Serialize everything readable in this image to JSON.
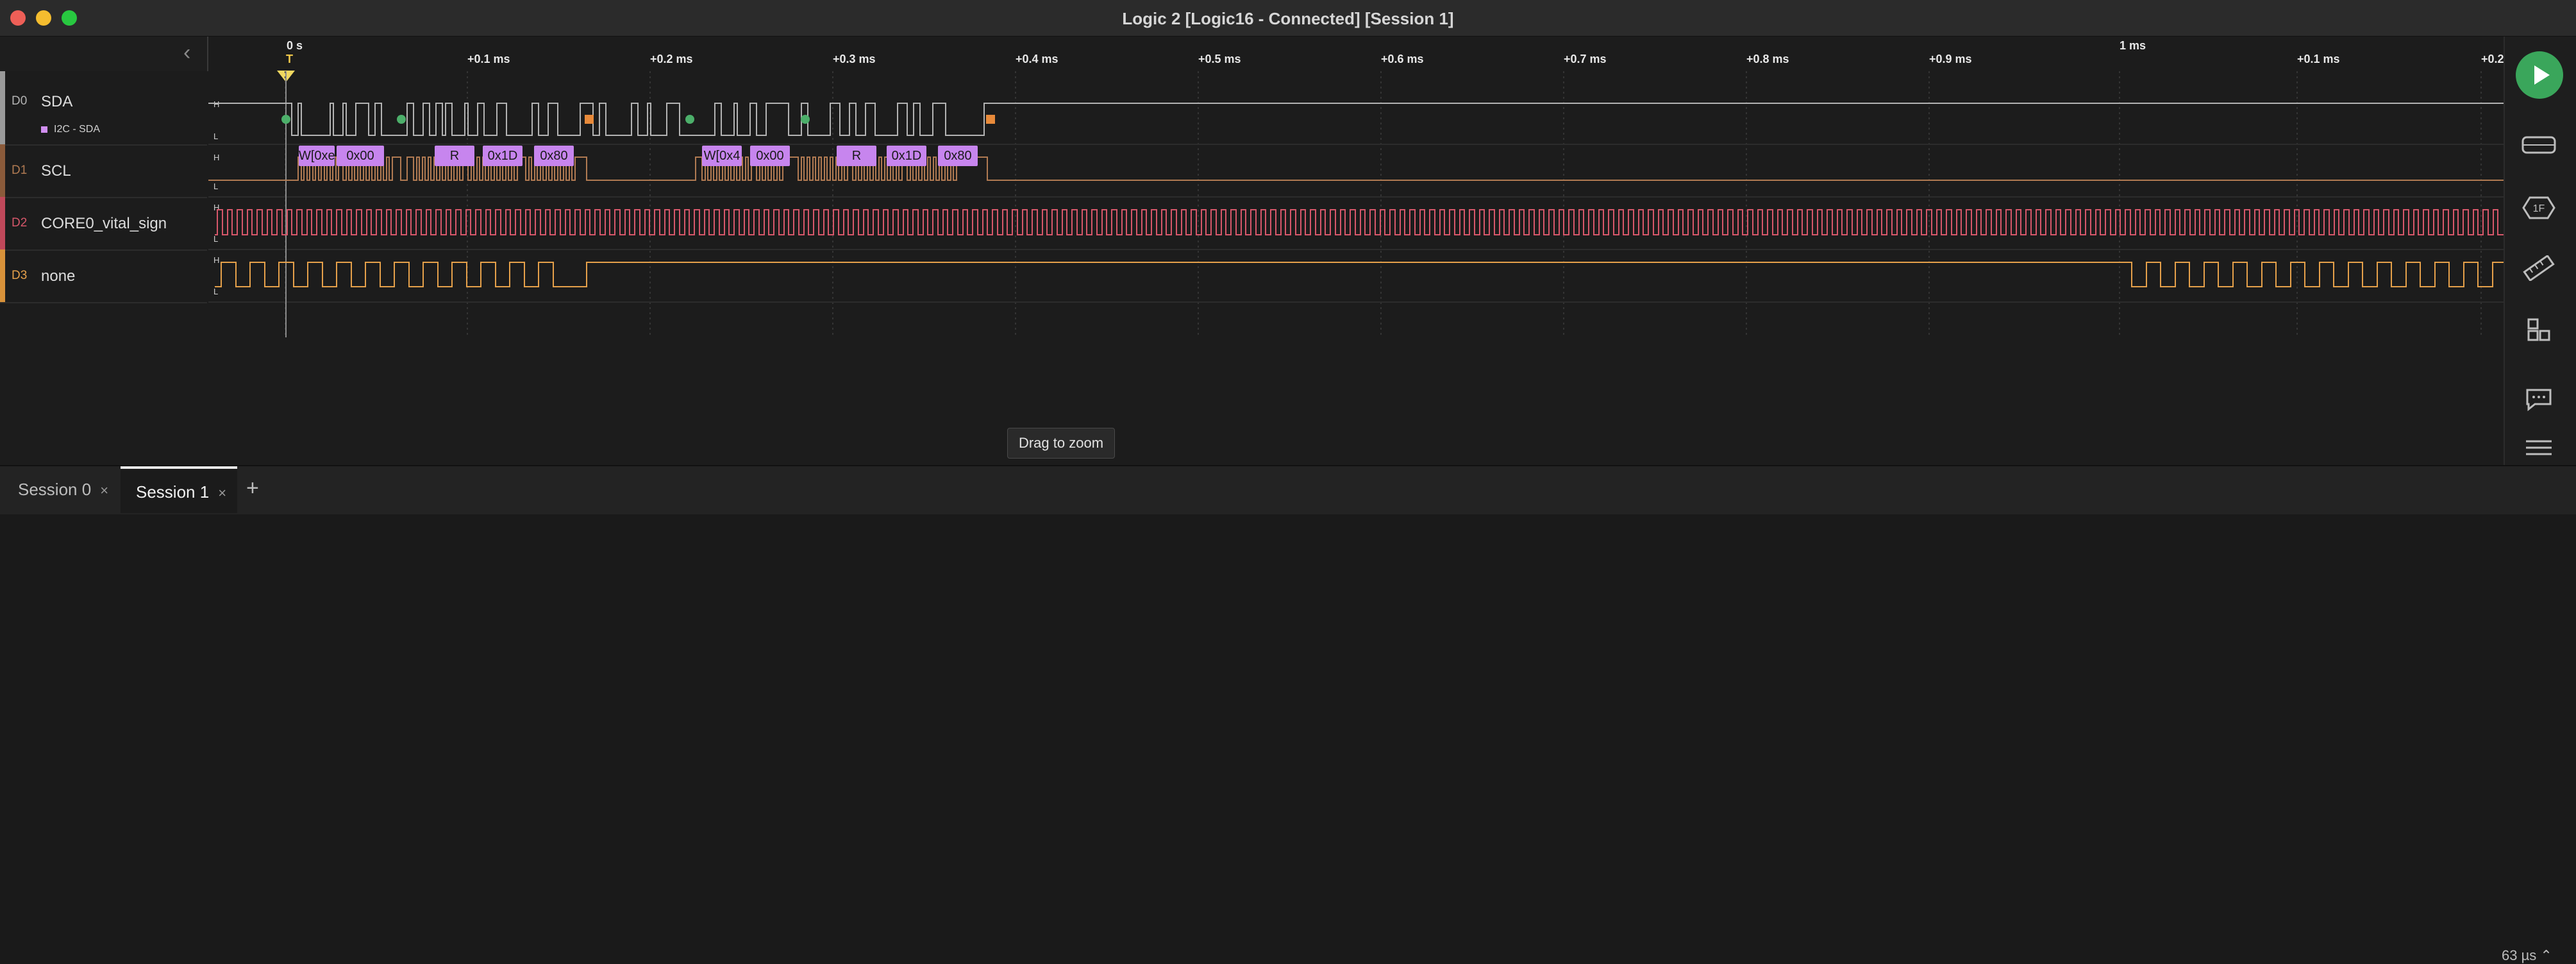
{
  "window": {
    "title": "Logic 2 [Logic16 - Connected] [Session 1]"
  },
  "ruler": {
    "origin": "0 s",
    "trigger": "T",
    "ticks": [
      "+0.1 ms",
      "+0.2 ms",
      "+0.3 ms",
      "+0.4 ms",
      "+0.5 ms",
      "+0.6 ms",
      "+0.7 ms",
      "+0.8 ms",
      "+0.9 ms",
      "+0.1 ms",
      "+0.2"
    ],
    "major": "1 ms"
  },
  "level_labels": {
    "high": "H",
    "low": "L"
  },
  "channels": [
    {
      "id": "D0",
      "name": "SDA",
      "color": "#b3b3b3",
      "analyzer": "I2C - SDA"
    },
    {
      "id": "D1",
      "name": "SCL",
      "color": "#b07a52"
    },
    {
      "id": "D2",
      "name": "CORE0_vital_sign",
      "color": "#d6576a"
    },
    {
      "id": "D3",
      "name": "none",
      "color": "#e5a04a"
    }
  ],
  "decoded": [
    "W[0xe",
    "0x00",
    "R",
    "0x1D",
    "0x80",
    "W[0x4",
    "0x00",
    "R",
    "0x1D",
    "0x80"
  ],
  "tooltip": "Drag to zoom",
  "tabs": [
    "Session 0",
    "Session 1"
  ],
  "status": {
    "time_per_div": "63 µs ⌃"
  },
  "colors": {
    "play": "#3aa65b",
    "decoder": "#c785ee",
    "start": "#4caf6a",
    "stop": "#e88a3a"
  }
}
